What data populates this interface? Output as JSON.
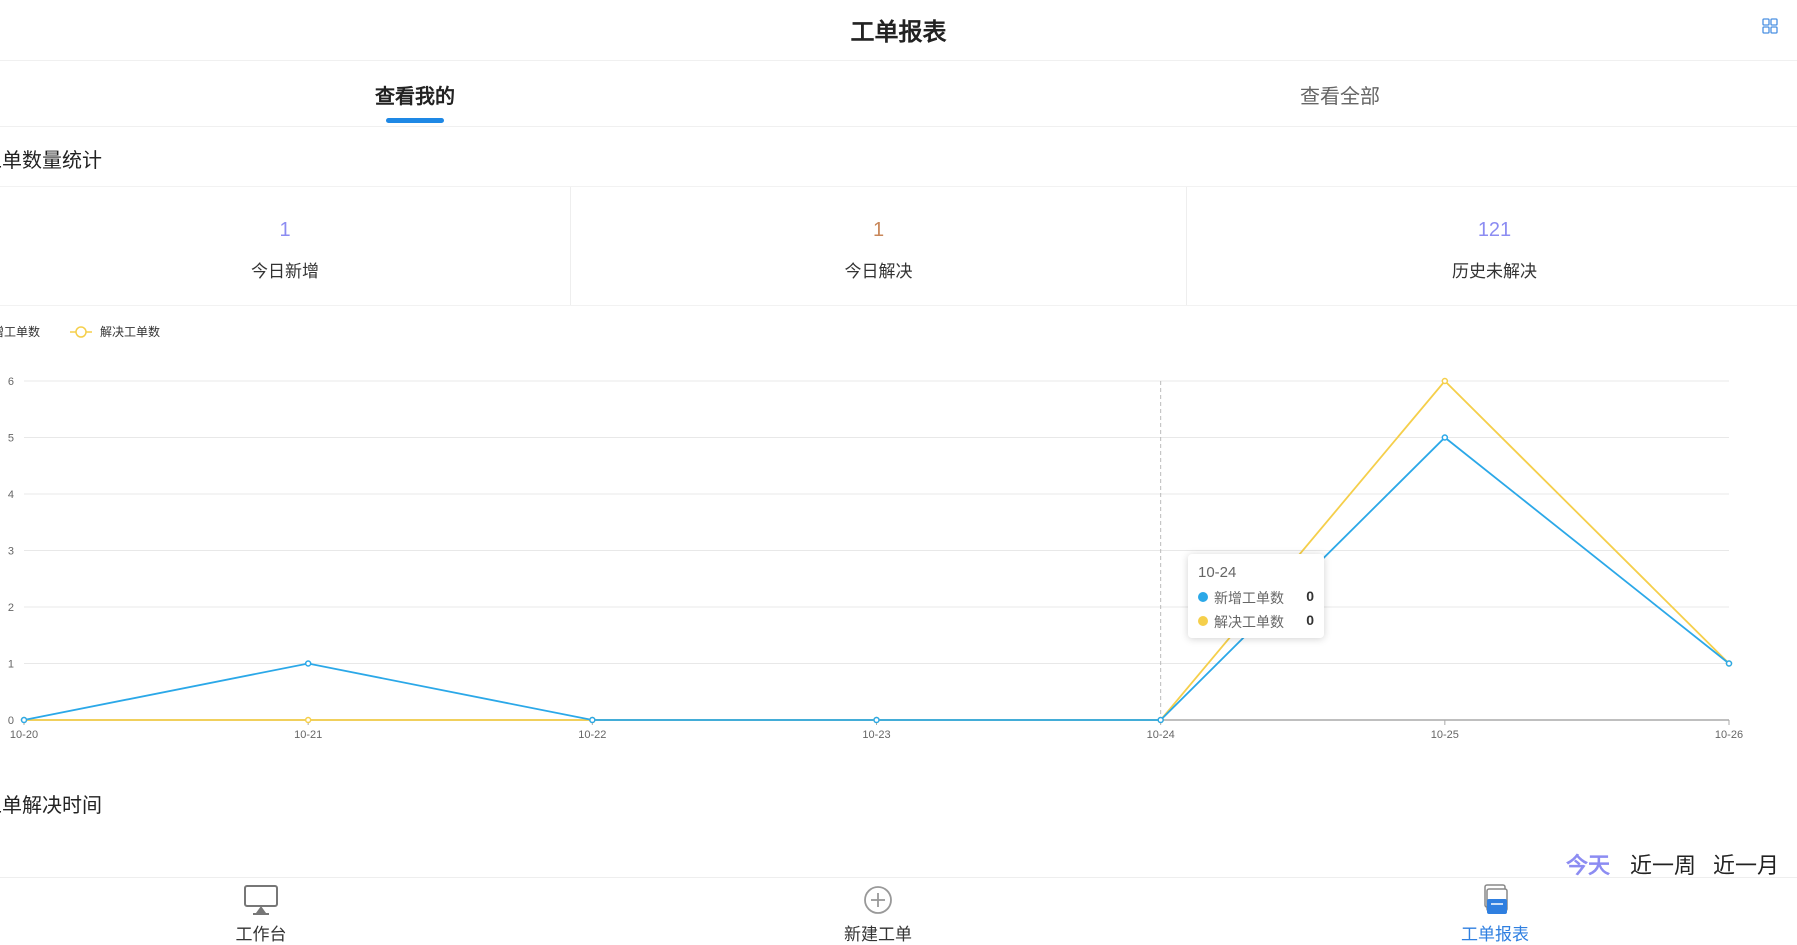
{
  "header": {
    "title": "工单报表",
    "grid_icon": "grid-icon"
  },
  "tabs": [
    {
      "label": "查看我的",
      "active": true
    },
    {
      "label": "查看全部",
      "active": false
    }
  ],
  "sections": {
    "count_title": "工单数量统计",
    "resolve_time_title": "工单解决时间"
  },
  "stats": [
    {
      "value": "1",
      "label": "今日新增",
      "color": "#8c8cf2"
    },
    {
      "value": "1",
      "label": "今日解决",
      "color": "#c8875a"
    },
    {
      "value": "121",
      "label": "历史未解决",
      "color": "#8c8cf2"
    }
  ],
  "chart_data": {
    "type": "line",
    "categories": [
      "10-20",
      "10-21",
      "10-22",
      "10-23",
      "10-24",
      "10-25",
      "10-26"
    ],
    "series": [
      {
        "name": "新增工单数",
        "values": [
          0,
          1,
          0,
          0,
          0,
          5,
          1
        ],
        "color": "#2ba8e8"
      },
      {
        "name": "解决工单数",
        "values": [
          0,
          0,
          0,
          0,
          0,
          6,
          1
        ],
        "color": "#f5cf4b"
      }
    ],
    "ylim": [
      0,
      6
    ],
    "yticks": [
      0,
      1,
      2,
      3,
      4,
      5,
      6
    ],
    "grid": true,
    "legend": "top-left",
    "highlight_index": 4
  },
  "tooltip": {
    "title": "10-24",
    "rows": [
      {
        "name": "新增工单数",
        "value": "0",
        "color": "#2ba8e8"
      },
      {
        "name": "解决工单数",
        "value": "0",
        "color": "#f5cf4b"
      }
    ]
  },
  "range_tabs": [
    {
      "label": "今天",
      "active": true
    },
    {
      "label": "近一周",
      "active": false
    },
    {
      "label": "近一月",
      "active": false
    }
  ],
  "bottom_nav": [
    {
      "label": "工作台",
      "icon": "monitor-icon",
      "active": false
    },
    {
      "label": "新建工单",
      "icon": "plus-circle-icon",
      "active": false
    },
    {
      "label": "工单报表",
      "icon": "report-icon",
      "active": true
    }
  ]
}
